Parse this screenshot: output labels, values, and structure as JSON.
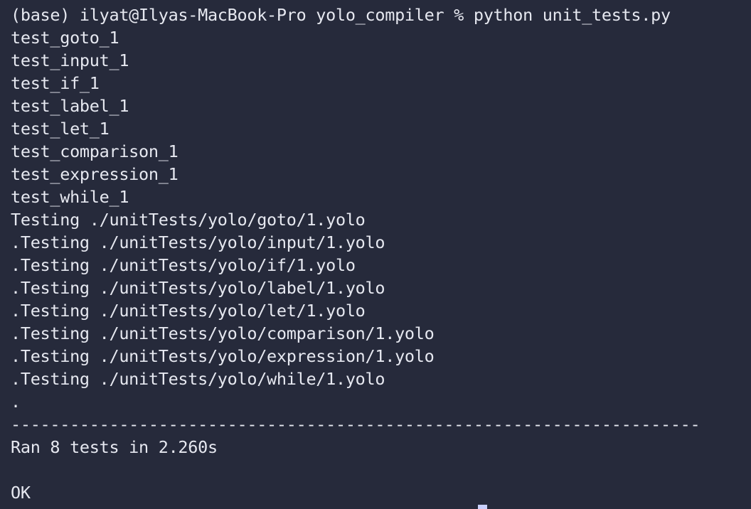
{
  "terminal": {
    "prompt_line": "(base) ilyat@Ilyas-MacBook-Pro yolo_compiler % python unit_tests.py",
    "output": [
      "test_goto_1",
      "test_input_1",
      "test_if_1",
      "test_label_1",
      "test_let_1",
      "test_comparison_1",
      "test_expression_1",
      "test_while_1",
      "Testing ./unitTests/yolo/goto/1.yolo",
      ".Testing ./unitTests/yolo/input/1.yolo",
      ".Testing ./unitTests/yolo/if/1.yolo",
      ".Testing ./unitTests/yolo/label/1.yolo",
      ".Testing ./unitTests/yolo/let/1.yolo",
      ".Testing ./unitTests/yolo/comparison/1.yolo",
      ".Testing ./unitTests/yolo/expression/1.yolo",
      ".Testing ./unitTests/yolo/while/1.yolo",
      ".",
      "----------------------------------------------------------------------",
      "Ran 8 tests in 2.260s",
      "",
      "OK"
    ]
  }
}
